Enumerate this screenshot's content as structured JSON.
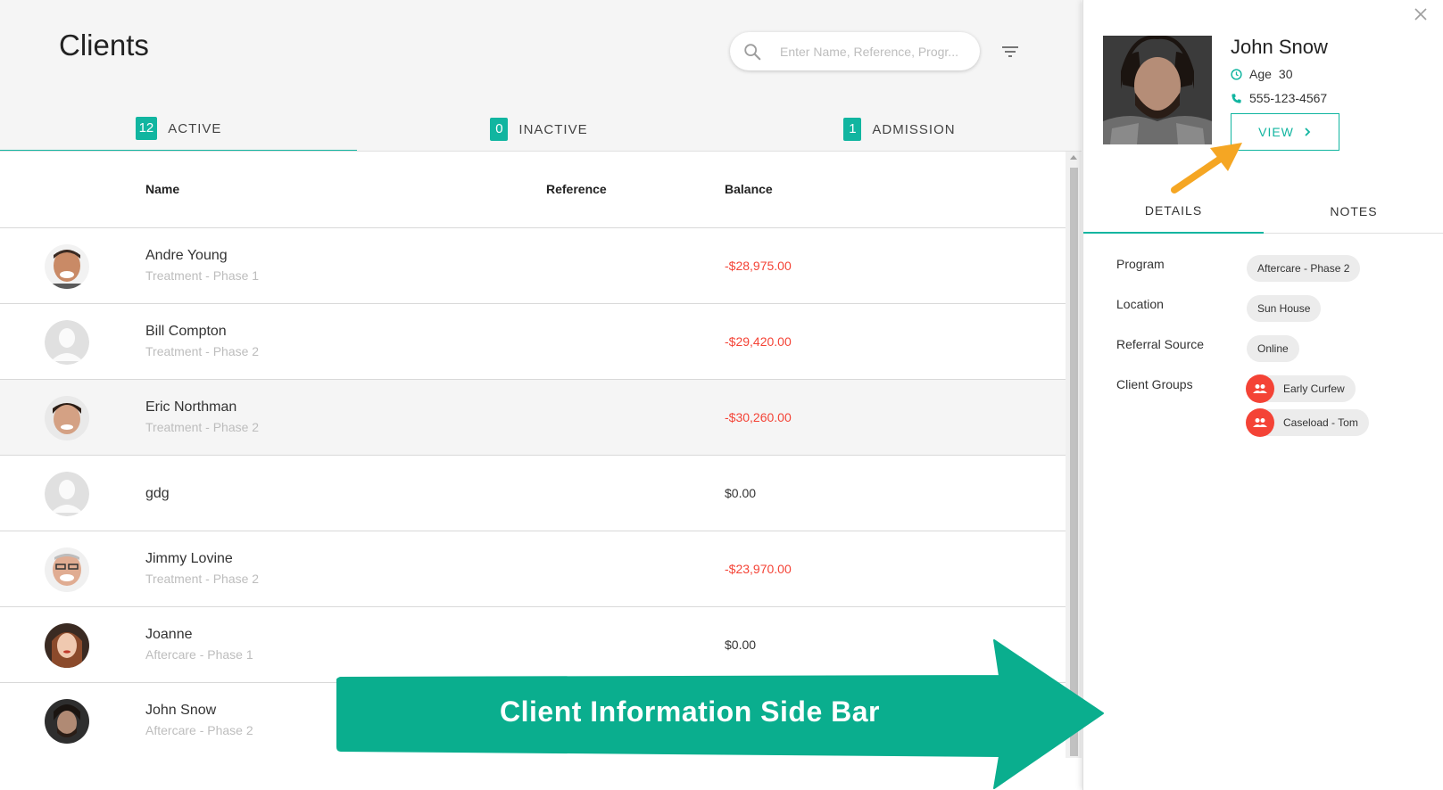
{
  "page": {
    "title": "Clients"
  },
  "search": {
    "placeholder": "Enter Name, Reference, Progr..."
  },
  "tabs": [
    {
      "count": "12",
      "label": "ACTIVE"
    },
    {
      "count": "0",
      "label": "INACTIVE"
    },
    {
      "count": "1",
      "label": "ADMISSION"
    }
  ],
  "table": {
    "headers": {
      "name": "Name",
      "reference": "Reference",
      "balance": "Balance"
    },
    "rows": [
      {
        "name": "Andre Young",
        "program": "Treatment - Phase 1",
        "balance": "-$28,975.00"
      },
      {
        "name": "Bill Compton",
        "program": "Treatment - Phase 2",
        "balance": "-$29,420.00"
      },
      {
        "name": "Eric Northman",
        "program": "Treatment - Phase 2",
        "balance": "-$30,260.00"
      },
      {
        "name": "gdg",
        "program": "",
        "balance": "$0.00"
      },
      {
        "name": "Jimmy Lovine",
        "program": "Treatment - Phase 2",
        "balance": "-$23,970.00"
      },
      {
        "name": "Joanne",
        "program": "Aftercare - Phase 1",
        "balance": "$0.00"
      },
      {
        "name": "John Snow",
        "program": "Aftercare - Phase 2",
        "balance": ""
      }
    ]
  },
  "sidebar": {
    "client_name": "John Snow",
    "age_label": "Age",
    "age": "30",
    "phone": "555-123-4567",
    "view_label": "VIEW",
    "tabs": [
      "DETAILS",
      "NOTES"
    ],
    "details": {
      "program_label": "Program",
      "program": "Aftercare - Phase 2",
      "location_label": "Location",
      "location": "Sun House",
      "referral_label": "Referral Source",
      "referral": "Online",
      "groups_label": "Client Groups",
      "groups": [
        "Early Curfew",
        "Caseload - Tom"
      ]
    }
  },
  "annotation": {
    "callout": "Client Information Side Bar"
  },
  "colors": {
    "accent": "#11b5a0",
    "negative": "#f44336",
    "arrow_orange": "#f5a623",
    "callout": "#0aae8e"
  }
}
